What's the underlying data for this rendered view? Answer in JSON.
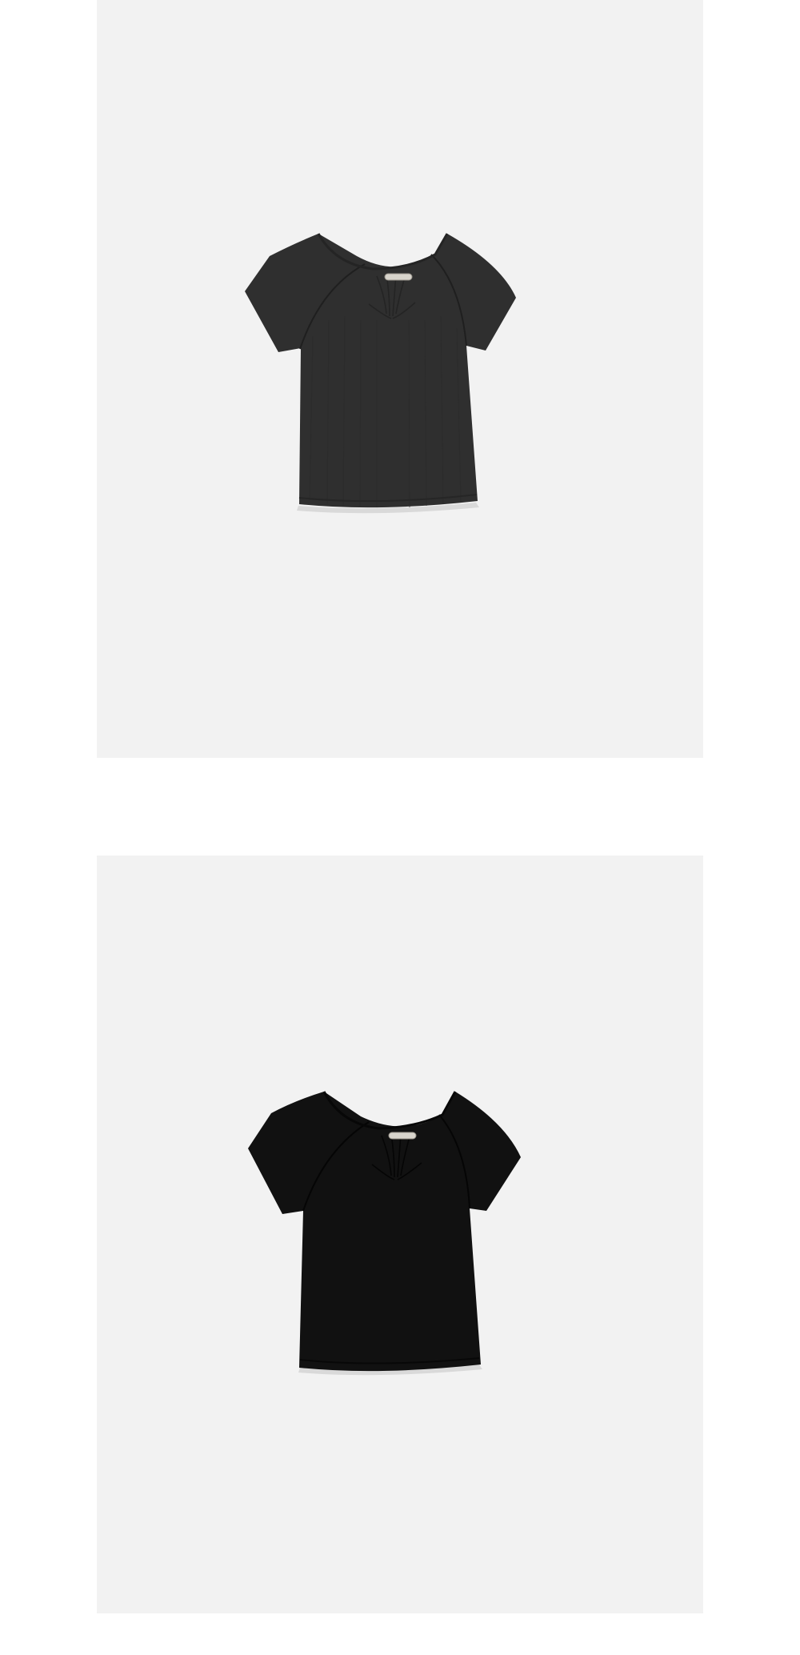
{
  "page": {
    "background_color": "#ffffff"
  },
  "products": [
    {
      "id_label": "product-photo-charcoal",
      "background_color": "#f2f2f2",
      "garment_color": "#2f2f2f",
      "garment_shade_color": "#1f1f1f",
      "garment_type": "short-sleeve ribbed crop top with gathered sweetheart neckline",
      "label_tag_color": "#d8d4cc"
    },
    {
      "id_label": "product-photo-black",
      "background_color": "#f2f2f2",
      "garment_color": "#111111",
      "garment_shade_color": "#050505",
      "garment_type": "short-sleeve ribbed crop top with gathered sweetheart neckline",
      "label_tag_color": "#d8d4cc"
    }
  ]
}
